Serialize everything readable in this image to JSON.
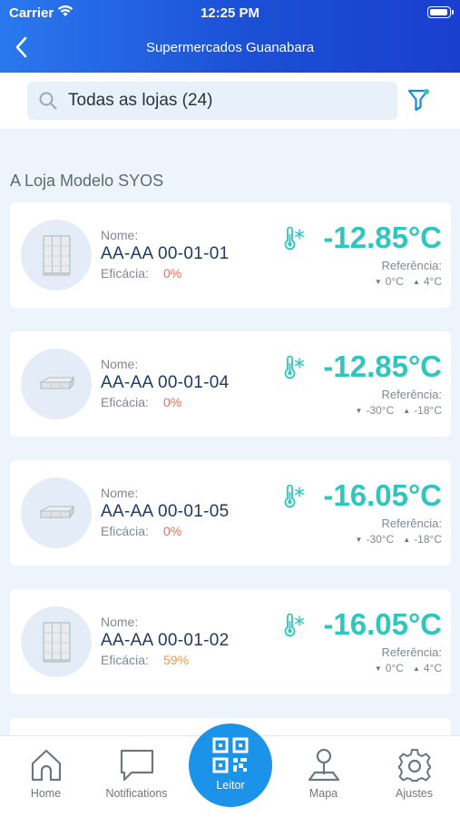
{
  "status_bar": {
    "carrier": "Carrier",
    "time": "12:25 PM"
  },
  "nav": {
    "title": "Supermercados Guanabara"
  },
  "search": {
    "text": "Todas as lojas (24)"
  },
  "section": {
    "title": "A Loja Modelo SYOS"
  },
  "labels": {
    "name": "Nome:",
    "efficacy": "Eficácia:",
    "reference": "Referência:"
  },
  "cards": [
    {
      "name": "AA-AA 00-01-01",
      "efficacy": "0%",
      "efficacy_color": "#ef6a5a",
      "temperature": "-12.85°C",
      "ref_min": "0°C",
      "ref_max": "4°C",
      "equipment_icon": "upright-fridge-icon"
    },
    {
      "name": "AA-AA 00-01-04",
      "efficacy": "0%",
      "efficacy_color": "#ef6a5a",
      "temperature": "-12.85°C",
      "ref_min": "-30°C",
      "ref_max": "-18°C",
      "equipment_icon": "chest-freezer-icon"
    },
    {
      "name": "AA-AA 00-01-05",
      "efficacy": "0%",
      "efficacy_color": "#ef6a5a",
      "temperature": "-16.05°C",
      "ref_min": "-30°C",
      "ref_max": "-18°C",
      "equipment_icon": "chest-freezer-icon"
    },
    {
      "name": "AA-AA 00-01-02",
      "efficacy": "59%",
      "efficacy_color": "#f29a3d",
      "temperature": "-16.05°C",
      "ref_min": "0°C",
      "ref_max": "4°C",
      "equipment_icon": "upright-fridge-icon"
    }
  ],
  "tabbar": {
    "home": "Home",
    "notifications": "Notifications",
    "reader": "Leitor",
    "map": "Mapa",
    "settings": "Ajustes"
  },
  "colors": {
    "header_start": "#2a78ee",
    "header_end": "#1a3fcf",
    "temperature": "#2ec7c0",
    "center_button": "#1a93e8"
  }
}
